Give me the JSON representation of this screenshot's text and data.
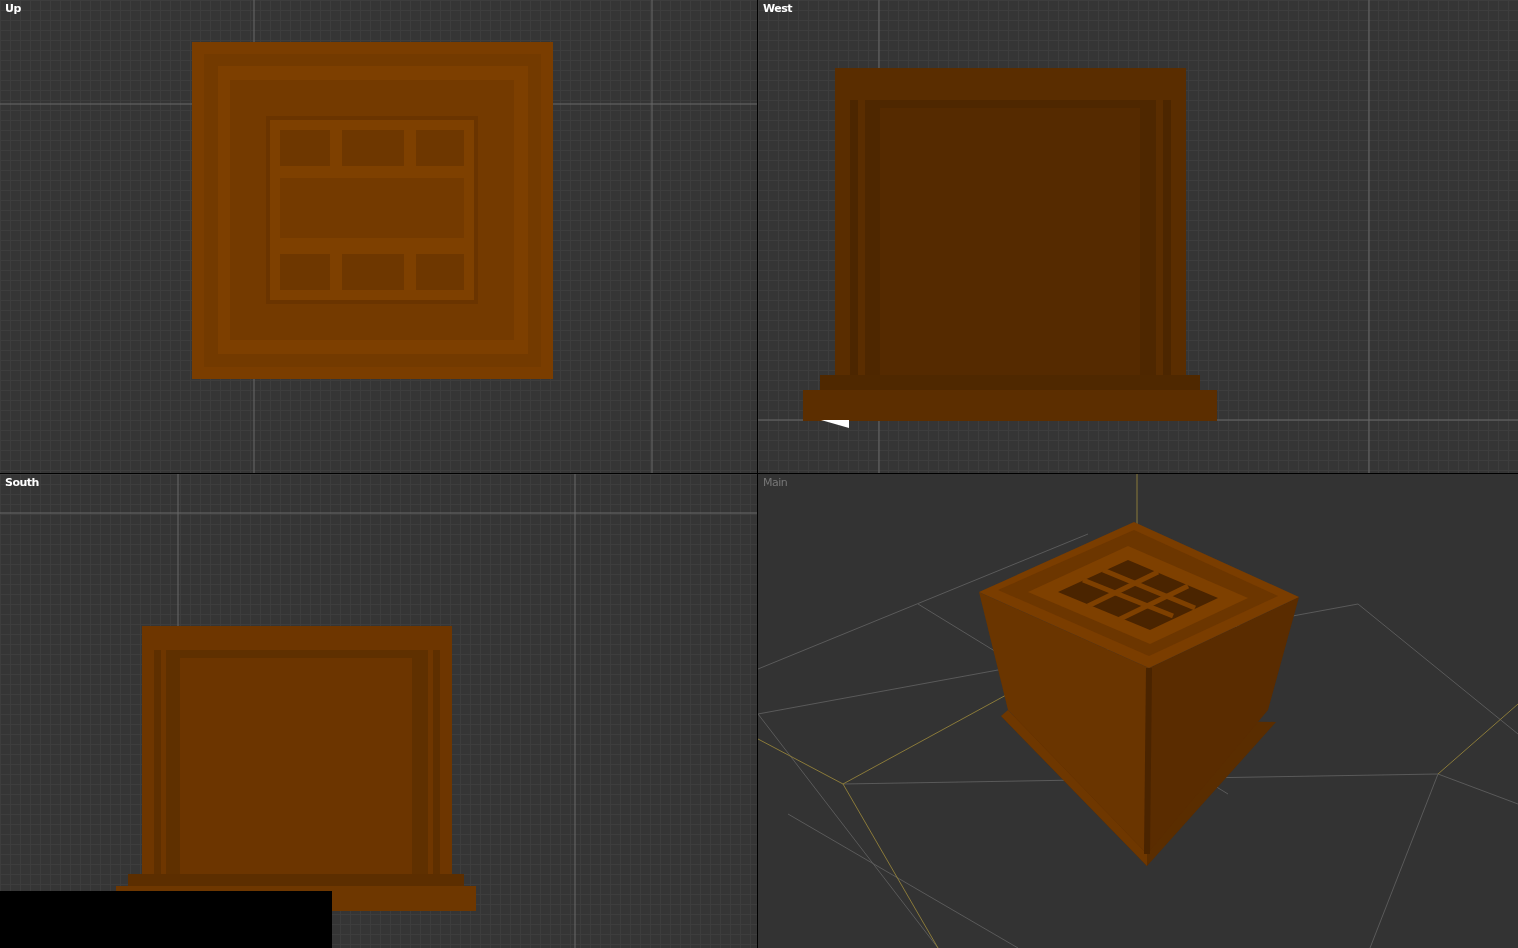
{
  "viewports": [
    {
      "label": "Up",
      "kind": "top",
      "dimmed": false
    },
    {
      "label": "West",
      "kind": "west",
      "dimmed": false
    },
    {
      "label": "South",
      "kind": "south",
      "dimmed": false
    },
    {
      "label": "Main",
      "kind": "perspective",
      "dimmed": true
    }
  ]
}
